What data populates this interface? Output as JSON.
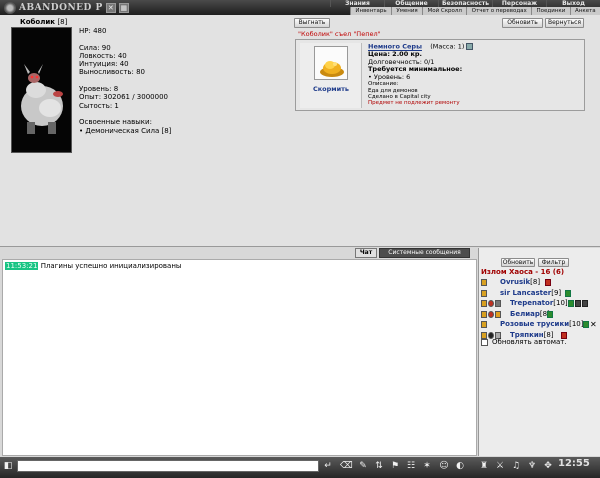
{
  "topbar": {
    "logo_text": "ABANDONED P",
    "menu": [
      "Знания",
      "Общение",
      "Безопасность",
      "Персонаж",
      "Выход"
    ],
    "submenu": [
      "Инвентарь",
      "Умения",
      "Мой Скролл",
      "Отчет о переводах",
      "Поединки",
      "Анкета"
    ]
  },
  "character": {
    "name": "Коболик",
    "level_tag": "[8]",
    "hp": "HP: 480",
    "stats": [
      "Сила: 90",
      "Ловкость: 40",
      "Интуиция: 40",
      "Выносливость: 80"
    ],
    "level": "Уровень: 8",
    "exp": "Опыт: 302061 / 3000000",
    "satiety": "Сытость: 1",
    "skills_title": "Освоенные навыки:",
    "skill": "• Демоническая Сила [8]"
  },
  "buttons": {
    "feed_out": "Выгнать",
    "refresh": "Обновить",
    "back": "Вернуться",
    "feed": "Скормить",
    "upd": "Обновить",
    "filter": "Фильтр"
  },
  "eat_message": "\"Коболик\" съел \"Пепел\"",
  "item": {
    "name": "Немного Серы",
    "mass": "(Масса: 1)",
    "price": "Цена: 2.00 кр.",
    "durability": "Долговечность: 0/1",
    "req_title": "Требуется минимальное:",
    "req_level": "• Уровень: 6",
    "desc_title": "Описание:",
    "desc": "Еда для демонов",
    "made_in": "Сделано в Capital city",
    "no_repair": "Предмет не подлежит ремонту"
  },
  "chat": {
    "tab_chat": "Чат",
    "tab_system": "Системные сообщения",
    "time": "11:53:21",
    "message": "Плагины успешно инициализированы"
  },
  "room": {
    "location": "Излом Хаоса - 16 (6)",
    "users": [
      {
        "name": "Ovrusik",
        "level": "[8]"
      },
      {
        "name": "sir Lancaster",
        "level": "[9]"
      },
      {
        "name": "Trepenator",
        "level": "[10]"
      },
      {
        "name": "Белиар",
        "level": "[8]"
      },
      {
        "name": "Розовые трусики",
        "level": "[10]"
      },
      {
        "name": "Тряпкин",
        "level": "[8]"
      }
    ],
    "auto_update": "Обновлять автомат."
  },
  "clock": "12:55"
}
